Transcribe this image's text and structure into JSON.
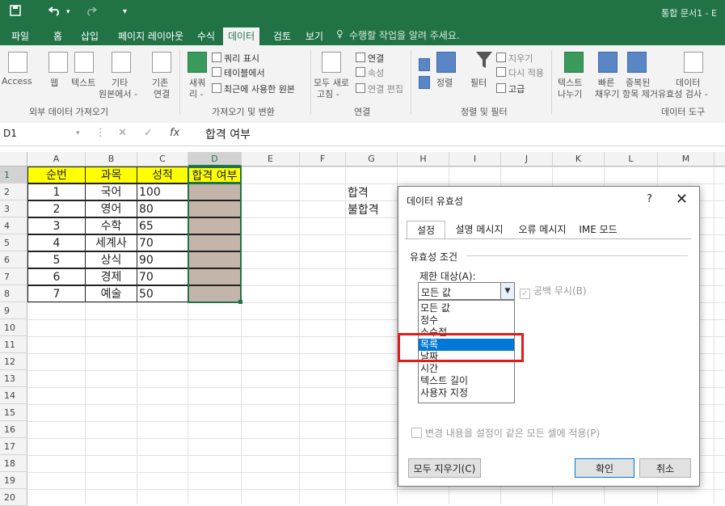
{
  "titlebar": {
    "save_icon": "save-icon",
    "undo_icon": "undo-icon",
    "redo_icon": "redo-icon",
    "doc_title": "통합 문서1 - E"
  },
  "menu": {
    "tabs": [
      "파일",
      "홈",
      "삽입",
      "페이지 레이아웃",
      "수식",
      "데이터",
      "검토",
      "보기"
    ],
    "active": "데이터",
    "tell_me": "수행할 작업을 알려 주세요."
  },
  "ribbon": {
    "get_external": {
      "access": "Access",
      "web": "웹",
      "text": "텍스트",
      "other": "기타",
      "other2": "원본에서 -",
      "existing": "기존",
      "existing2": "연결",
      "group": "외부 데이터 가져오기"
    },
    "get_transform": {
      "new_query": "새쿼",
      "new_query2": "리 -",
      "show_queries": "쿼리 표시",
      "from_table": "테이블에서",
      "recent_sources": "최근에 사용한 원본",
      "group": "가져오기 및 변환"
    },
    "connections": {
      "refresh_all": "모두 새로",
      "refresh_all2": "고침 -",
      "connections": "연결",
      "properties": "속성",
      "edit_links": "연결 편집",
      "group": "연결"
    },
    "sort_filter": {
      "sort": "정렬",
      "filter": "필터",
      "clear": "지우기",
      "reapply": "다시 적용",
      "advanced": "고급",
      "group": "정렬 및 필터"
    },
    "data_tools": {
      "text_to_columns": "텍스트",
      "text_to_columns2": "나누기",
      "flash_fill": "빠른",
      "flash_fill2": "채우기",
      "remove_dup": "중복된",
      "remove_dup2": "항목 제거",
      "validation": "데이터",
      "validation2": "유효성 검사 -",
      "group": "데이터 도구"
    }
  },
  "formula_bar": {
    "name_box": "D1",
    "fx": "fx",
    "formula": "합격 여부"
  },
  "grid": {
    "columns": [
      "A",
      "B",
      "C",
      "D",
      "E",
      "F",
      "G",
      "H",
      "I",
      "J",
      "K",
      "L",
      "M"
    ],
    "selected_column": "D",
    "rows": [
      "1",
      "2",
      "3",
      "4",
      "5",
      "6",
      "7",
      "8",
      "9",
      "10",
      "11",
      "12",
      "13",
      "14",
      "15",
      "16",
      "17",
      "18",
      "19",
      "20"
    ],
    "header": [
      "순번",
      "과목",
      "성적",
      "합격 여부"
    ],
    "data": [
      [
        "1",
        "국어",
        "100"
      ],
      [
        "2",
        "영어",
        "80"
      ],
      [
        "3",
        "수학",
        "65"
      ],
      [
        "4",
        "세계사",
        "70"
      ],
      [
        "5",
        "상식",
        "90"
      ],
      [
        "6",
        "경제",
        "70"
      ],
      [
        "7",
        "예술",
        "50"
      ]
    ],
    "g_values": [
      "합격",
      "불합격"
    ]
  },
  "dialog": {
    "title": "데이터 유효성",
    "help": "?",
    "close": "✕",
    "tabs": [
      "설정",
      "설명 메시지",
      "오류 메시지",
      "IME 모드"
    ],
    "section": "유효성 조건",
    "allow_label": "제한 대상(A):",
    "allow_value": "모든 값",
    "ignore_blank": "공백 무시(B)",
    "options": [
      "모든 값",
      "정수",
      "소수점",
      "목록",
      "날짜",
      "시간",
      "텍스트 길이",
      "사용자 지정"
    ],
    "selected_option": "목록",
    "apply_all": "변경 내용을 설정이 같은 모든 셀에 적용(P)",
    "clear_all": "모두 지우기(C)",
    "ok": "확인",
    "cancel": "취소"
  },
  "colors": {
    "excel_green": "#217346",
    "header_yellow": "#ffff00",
    "tan_fill": "#c4b5aa",
    "selection_blue": "#0078d7",
    "highlight_red": "#e21b1b"
  }
}
